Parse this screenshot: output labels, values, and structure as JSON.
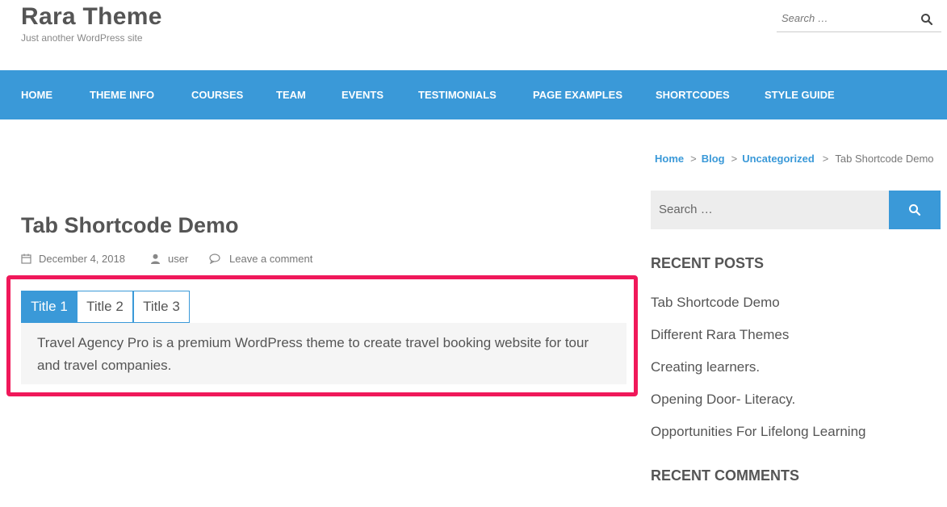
{
  "site": {
    "title": "Rara Theme",
    "tagline": "Just another WordPress site"
  },
  "header_search": {
    "placeholder": "Search …"
  },
  "nav": {
    "items": [
      "HOME",
      "THEME INFO",
      "COURSES",
      "TEAM",
      "EVENTS",
      "TESTIMONIALS",
      "PAGE EXAMPLES",
      "SHORTCODES",
      "STYLE GUIDE"
    ]
  },
  "breadcrumb": {
    "home": "Home",
    "blog": "Blog",
    "category": "Uncategorized",
    "current": "Tab Shortcode Demo",
    "separator": ">"
  },
  "post": {
    "title": "Tab Shortcode Demo",
    "date": "December 4, 2018",
    "author": "user",
    "comments": "Leave a comment"
  },
  "tabs": {
    "items": [
      "Title 1",
      "Title 2",
      "Title 3"
    ],
    "active_index": 0,
    "content": "Travel Agency Pro is a premium WordPress theme to create travel booking website for tour and travel companies."
  },
  "sidebar": {
    "search_placeholder": "Search …",
    "recent_posts_title": "RECENT POSTS",
    "recent_posts": [
      "Tab Shortcode Demo",
      "Different Rara Themes",
      "Creating learners.",
      "Opening Door- Literacy.",
      "Opportunities For Lifelong Learning"
    ],
    "recent_comments_title": "RECENT COMMENTS"
  },
  "colors": {
    "accent": "#3a99d8",
    "highlight": "#f0185a"
  }
}
